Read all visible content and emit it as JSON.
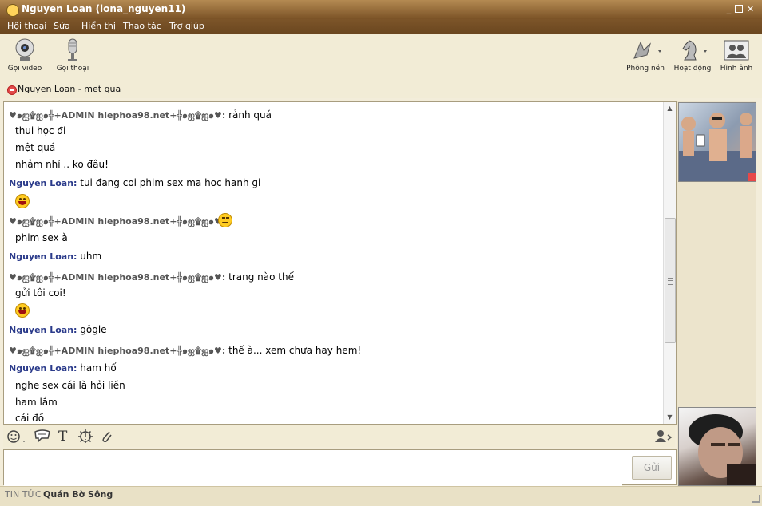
{
  "window": {
    "title": "Nguyen Loan (lona_nguyen11)"
  },
  "menu": [
    "Hội thoại",
    "Sửa",
    "Hiển thị",
    "Thao tác",
    "Trợ giúp"
  ],
  "toolbar": {
    "video_call": "Gọi video",
    "voice_call": "Gọi thoại",
    "background": "Phông nền",
    "activities": "Hoạt động",
    "photos": "Hình ảnh"
  },
  "contact_status": {
    "name": "Nguyen Loan",
    "message": "met qua"
  },
  "admin_sender": "♥๑ஐ۩ஐ๑╬+ADMIN hiephoa98.net+╬๑ஐ۩ஐ๑♥:",
  "nguyen_sender": "Nguyen Loan:",
  "messages": {
    "m1": "rảnh quá",
    "m2": "thui học đi",
    "m3": "mệt quá",
    "m4": "nhảm nhí .. ko đâu!",
    "m5": "tui đang coi phim sex ma hoc hanh gi",
    "m6": "phim sex à",
    "m7": "uhm",
    "m8": "trang nào thế",
    "m9": "gửi tôi coi!",
    "m10": "gôgle",
    "m11": "thế à... xem chưa hay hem!",
    "m12": "ham hố",
    "m13": "nghe sex cái là hỏi liền",
    "m14": "ham lắm",
    "m15": "cái đồ"
  },
  "input": {
    "send_label": "Gửi"
  },
  "footer": {
    "label": "TIN TỨC",
    "value": "Quán Bờ Sông"
  }
}
